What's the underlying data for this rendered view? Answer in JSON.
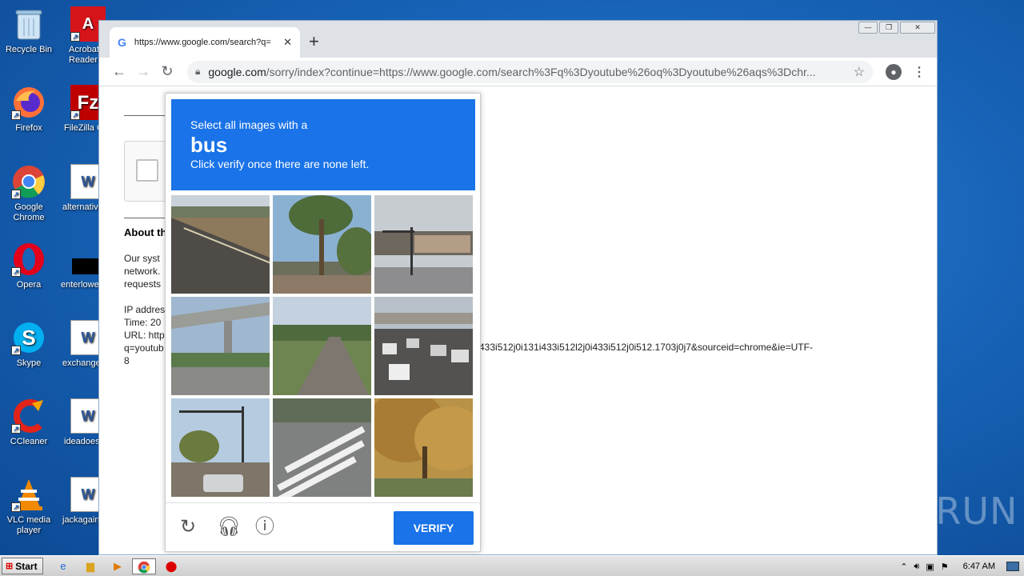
{
  "desktop": {
    "icons_col1": [
      {
        "label": "Recycle Bin",
        "icon": "recycle-bin-icon"
      },
      {
        "label": "Firefox",
        "icon": "firefox-icon"
      },
      {
        "label": "Google Chrome",
        "icon": "chrome-icon"
      },
      {
        "label": "Opera",
        "icon": "opera-icon"
      },
      {
        "label": "Skype",
        "icon": "skype-icon"
      },
      {
        "label": "CCleaner",
        "icon": "ccleaner-icon"
      },
      {
        "label": "VLC media player",
        "icon": "vlc-icon"
      }
    ],
    "icons_col2": [
      {
        "label": "Acrobat Reader",
        "icon": "acrobat-icon"
      },
      {
        "label": "FileZilla Client",
        "icon": "filezilla-icon"
      },
      {
        "label": "alternativ",
        "icon": "word-doc-icon"
      },
      {
        "label": "enterlowe",
        "icon": "black-file-icon"
      },
      {
        "label": "exchange",
        "icon": "word-doc-icon"
      },
      {
        "label": "ideadoes",
        "icon": "word-doc-icon"
      },
      {
        "label": "jackagain",
        "icon": "word-doc-icon"
      }
    ]
  },
  "browser": {
    "tab_title": "https://www.google.com/search?q=",
    "new_tab": "+",
    "url_host": "google.com",
    "url_rest": "/sorry/index?continue=https://www.google.com/search%3Fq%3Dyoutube%26oq%3Dyoutube%26aqs%3Dchr...",
    "window_buttons": [
      "—",
      "❐",
      "✕"
    ]
  },
  "page": {
    "about_heading": "About th",
    "para1": [
      "Our syst",
      "network.",
      "requests"
    ],
    "para2": [
      "IP addres",
      "Time: 20",
      "URL: http",
      "q=youtub",
      "8"
    ],
    "url_tail": "433i512j0i131i433i512l2j0i433i512j0i512.1703j0j7&sourceid=chrome&ie=UTF-"
  },
  "captcha": {
    "instruction_line1": "Select all images with a",
    "target": "bus",
    "instruction_line3": "Click verify once there are none left.",
    "verify_label": "VERIFY",
    "header_color": "#1a73e8",
    "tiles": [
      "road-shoulder",
      "palm-trees",
      "intersection",
      "overpass",
      "empty-road",
      "highway-traffic",
      "traffic-lights",
      "crosswalk",
      "autumn-tree"
    ]
  },
  "watermark": "ANY▷RUN",
  "taskbar": {
    "start_label": "Start",
    "clock": "6:47 AM"
  }
}
